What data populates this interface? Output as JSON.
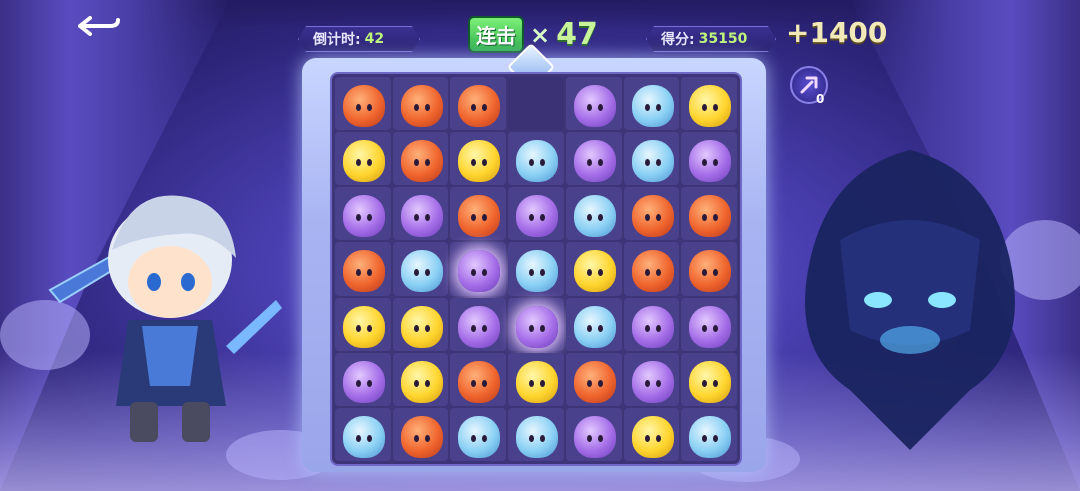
{
  "hud": {
    "timer_label": "倒计时:",
    "timer_value": "42",
    "combo_label": "连击",
    "combo_x": "×",
    "combo_value": "47",
    "score_label": "得分:",
    "score_value": "35150",
    "score_gain": "+1400"
  },
  "powerup": {
    "icon": "lightning-arrow-icon",
    "count": "0"
  },
  "back_icon": "back-arrow-icon",
  "colors": {
    "red": "#f0652e",
    "yellow": "#ffd52e",
    "purple": "#a56ee8",
    "blue": "#8ad0f4"
  },
  "board": {
    "rows": 7,
    "cols": 7,
    "grid": [
      [
        "red",
        "red",
        "red",
        "",
        "purple",
        "blue",
        "yellow"
      ],
      [
        "yellow",
        "red",
        "yellow",
        "blue",
        "purple",
        "blue",
        "purple"
      ],
      [
        "purple",
        "purple",
        "red",
        "purple",
        "blue",
        "red",
        "red"
      ],
      [
        "red",
        "blue",
        "purple*",
        "blue",
        "yellow",
        "red",
        "red"
      ],
      [
        "yellow",
        "yellow",
        "purple",
        "purple*",
        "blue",
        "purple",
        "purple"
      ],
      [
        "purple",
        "yellow",
        "red",
        "yellow",
        "red",
        "purple",
        "yellow"
      ],
      [
        "blue",
        "red",
        "blue",
        "blue",
        "purple",
        "yellow",
        "blue"
      ]
    ]
  }
}
